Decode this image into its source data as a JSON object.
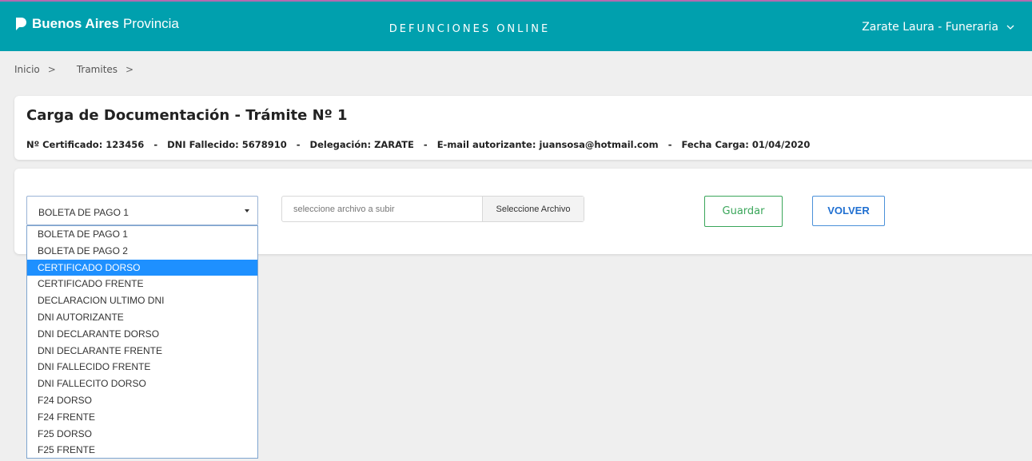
{
  "header": {
    "brand_bold": "Buenos Aires",
    "brand_light": "Provincia",
    "app_title": "DEFUNCIONES ONLINE",
    "user_label": "Zarate Laura - Funeraria",
    "icons": {
      "brand": "province-logo-icon",
      "user_menu": "chevron-down-icon"
    },
    "colors": {
      "bar": "#00a0ae",
      "accent_line": "#b36bb0"
    }
  },
  "breadcrumb": {
    "items": [
      "Inicio",
      "Tramites"
    ],
    "separator": ">"
  },
  "summary": {
    "title": "Carga de Documentación - Trámite Nº 1",
    "fields": [
      {
        "label": "Nº Certificado:",
        "value": "123456"
      },
      {
        "label": "DNI Fallecido:",
        "value": "5678910"
      },
      {
        "label": "Delegación:",
        "value": "ZARATE"
      },
      {
        "label": "E-mail autorizante:",
        "value": "juansosa@hotmail.com"
      },
      {
        "label": "Fecha Carga:",
        "value": "01/04/2020"
      }
    ],
    "separator": "-"
  },
  "form": {
    "doc_type_select": {
      "value": "BOLETA DE PAGO 1",
      "expanded": true,
      "highlighted": "CERTIFICADO DORSO",
      "options": [
        "BOLETA DE PAGO 1",
        "BOLETA DE PAGO 2",
        "CERTIFICADO DORSO",
        "CERTIFICADO FRENTE",
        "DECLARACION ULTIMO DNI",
        "DNI AUTORIZANTE",
        "DNI DECLARANTE DORSO",
        "DNI DECLARANTE FRENTE",
        "DNI FALLECIDO FRENTE",
        "DNI FALLECITO DORSO",
        "F24 DORSO",
        "F24 FRENTE",
        "F25 DORSO",
        "F25 FRENTE"
      ]
    },
    "file_input": {
      "placeholder": "seleccione archivo a subir",
      "button_label": "Seleccione Archivo"
    },
    "save_label": "Guardar",
    "back_label": "VOLVER",
    "colors": {
      "save": "#3aa65a",
      "back": "#1f6fd1",
      "highlight": "#1e90ff"
    }
  }
}
